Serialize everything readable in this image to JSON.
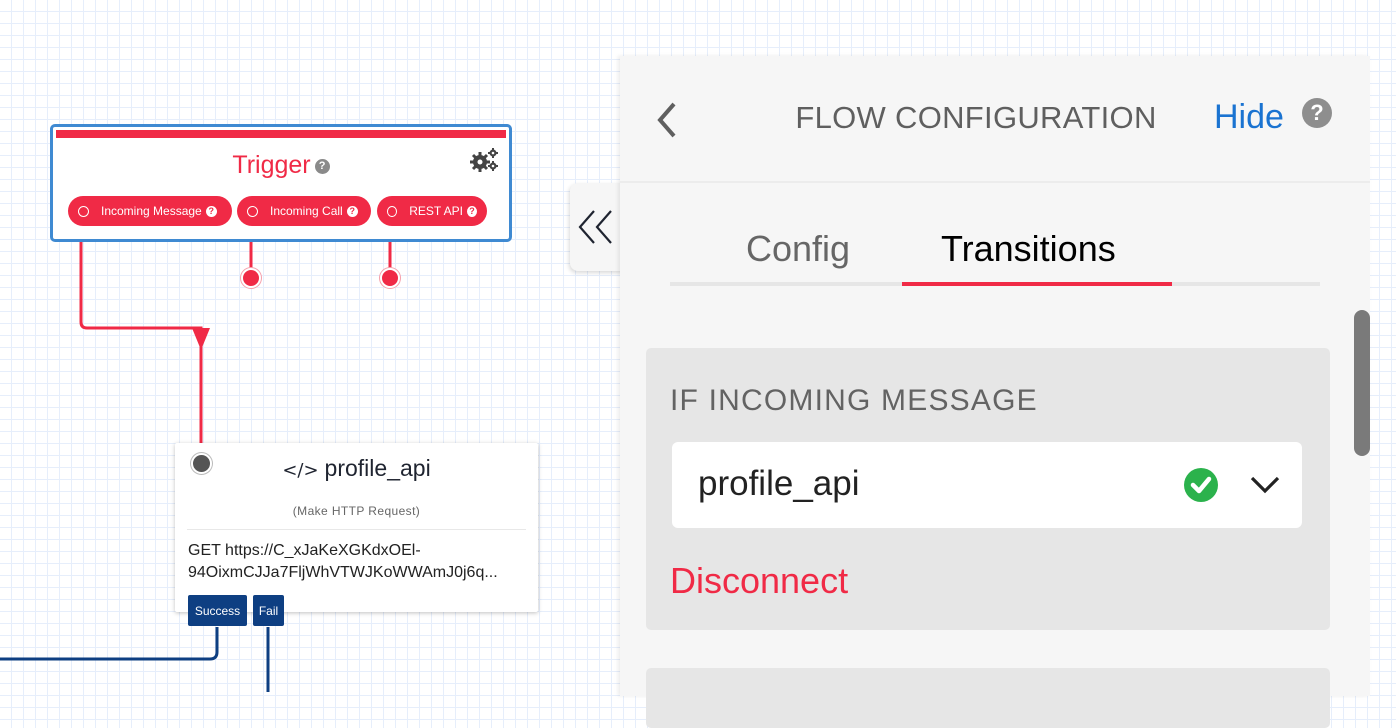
{
  "canvas": {
    "trigger_node": {
      "title": "Trigger",
      "help_icon": "question-circle-icon",
      "settings_icon": "gears-icon",
      "triggers": [
        {
          "label": "Incoming Message",
          "connected": true
        },
        {
          "label": "Incoming Call",
          "connected": false
        },
        {
          "label": "REST API",
          "connected": false
        }
      ]
    },
    "widget_node": {
      "icon": "code-icon",
      "icon_glyph": "</>",
      "name": "profile_api",
      "type_label": "(Make HTTP Request)",
      "url_line1": "GET https://C_xJaKeXGKdxOEl-",
      "url_line2": "94OixmCJJa7FljWhVTWJKoWWAmJ0j6q...",
      "outputs": [
        {
          "label": "Success"
        },
        {
          "label": "Fail"
        }
      ]
    },
    "colors": {
      "trigger_accent": "#f02a46",
      "selected_border": "#3f8ad2",
      "output_blue": "#0e3f82"
    }
  },
  "panel": {
    "collapse_icon": "double-chevron-left-icon",
    "back_icon": "chevron-left-icon",
    "title": "FLOW CONFIGURATION",
    "hide_label": "Hide",
    "help_icon": "question-circle-icon",
    "tabs": [
      {
        "label": "Config",
        "active": false
      },
      {
        "label": "Transitions",
        "active": true
      }
    ],
    "transitions": [
      {
        "condition_label": "IF INCOMING MESSAGE",
        "selected_widget": "profile_api",
        "status_icon": "check-circle-icon",
        "dropdown_icon": "chevron-down-icon",
        "disconnect_label": "Disconnect"
      }
    ]
  }
}
